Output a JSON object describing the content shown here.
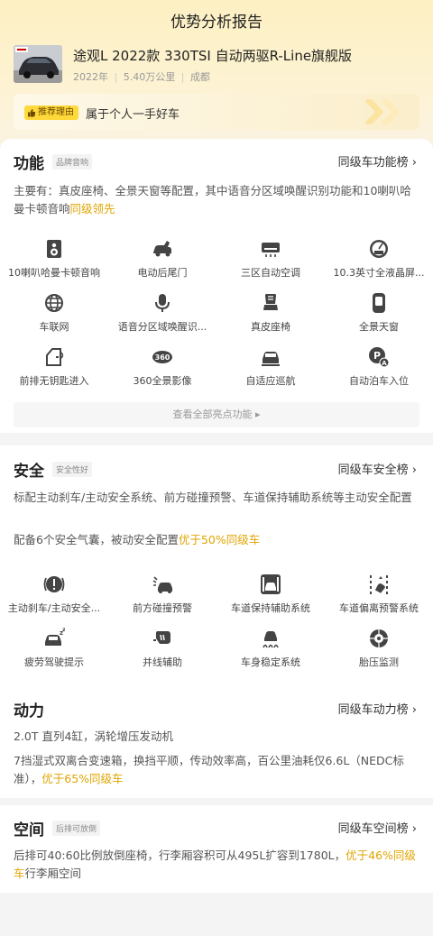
{
  "header": {
    "title": "优势分析报告"
  },
  "car": {
    "name": "途观L 2022款 330TSI 自动两驱R-Line旗舰版",
    "year": "2022年",
    "mileage": "5.40万公里",
    "city": "成都",
    "sep": "|"
  },
  "reason": {
    "badge": "推荐理由",
    "text": "属于个人一手好车"
  },
  "function": {
    "title": "功能",
    "tag": "品牌音响",
    "link": "同级车功能榜 ›",
    "desc_prefix": "主要有：真皮座椅、全景天窗等配置，其中语音分区域唤醒识别功能和10喇叭哈曼卡顿音响",
    "desc_highlight": "同级领先",
    "items": [
      {
        "label": "10喇叭哈曼卡顿音响",
        "icon": "speaker-icon"
      },
      {
        "label": "电动后尾门",
        "icon": "tailgate-icon"
      },
      {
        "label": "三区自动空调",
        "icon": "air-conditioner-icon"
      },
      {
        "label": "10.3英寸全液晶屏...",
        "icon": "lcd-gauge-icon"
      },
      {
        "label": "车联网",
        "icon": "globe-icon"
      },
      {
        "label": "语音分区域唤醒识...",
        "icon": "microphone-icon"
      },
      {
        "label": "真皮座椅",
        "icon": "seat-icon"
      },
      {
        "label": "全景天窗",
        "icon": "sunroof-icon"
      },
      {
        "label": "前排无钥匙进入",
        "icon": "door-icon"
      },
      {
        "label": "360全景影像",
        "icon": "camera-360-icon"
      },
      {
        "label": "自适应巡航",
        "icon": "cruise-icon"
      },
      {
        "label": "自动泊车入位",
        "icon": "parking-icon"
      }
    ],
    "view_all": "查看全部亮点功能 ▸"
  },
  "safety": {
    "title": "安全",
    "tag": "安全性好",
    "link": "同级车安全榜 ›",
    "desc1": "标配主动刹车/主动安全系统、前方碰撞预警、车道保持辅助系统等主动安全配置",
    "desc2_prefix": "配备6个安全气囊，被动安全配置",
    "desc2_highlight": "优于50%同级车",
    "items": [
      {
        "label": "主动刹车/主动安全...",
        "icon": "brake-icon"
      },
      {
        "label": "前方碰撞预警",
        "icon": "collision-icon"
      },
      {
        "label": "车道保持辅助系统",
        "icon": "lane-keep-icon"
      },
      {
        "label": "车道偏离预警系统",
        "icon": "lane-departure-icon"
      },
      {
        "label": "疲劳驾驶提示",
        "icon": "fatigue-icon"
      },
      {
        "label": "并线辅助",
        "icon": "mirror-icon"
      },
      {
        "label": "车身稳定系统",
        "icon": "stability-icon"
      },
      {
        "label": "胎压监测",
        "icon": "tire-icon"
      }
    ]
  },
  "power": {
    "title": "动力",
    "link": "同级车动力榜 ›",
    "desc1": "2.0T 直列4缸，涡轮增压发动机",
    "desc2_prefix": "7挡湿式双离合变速箱，换挡平顺，传动效率高，百公里油耗仅6.6L（NEDC标准），",
    "desc2_highlight": "优于65%同级车"
  },
  "space": {
    "title": "空间",
    "tag": "后排可放倒",
    "link": "同级车空间榜 ›",
    "desc_prefix": "后排可40:60比例放倒座椅，行李厢容积可从495L扩容到1780L，",
    "desc_highlight": "优于46%同级车",
    "desc_suffix": "行李厢空间"
  }
}
